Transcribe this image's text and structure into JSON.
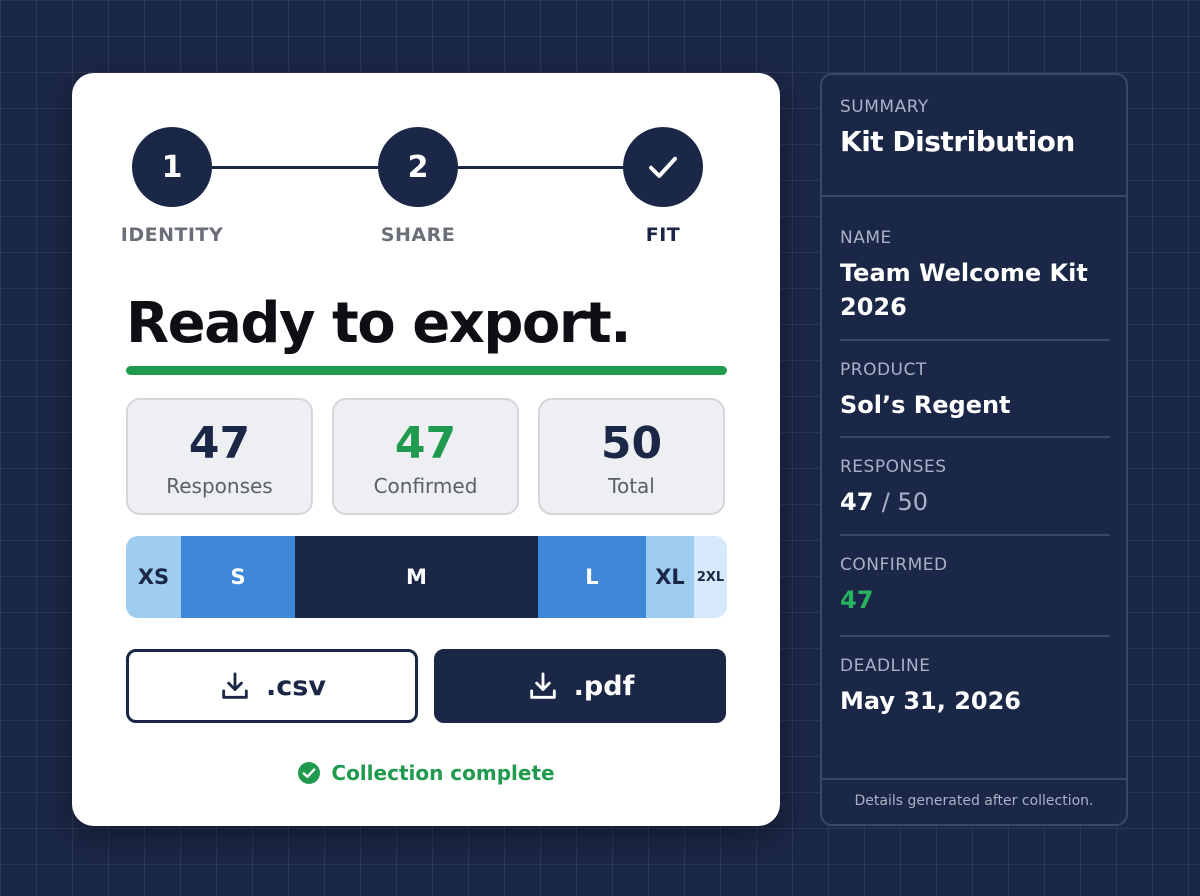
{
  "stepper": {
    "steps": [
      {
        "marker": "1",
        "label": "IDENTITY"
      },
      {
        "marker": "2",
        "label": "SHARE"
      },
      {
        "marker": "check-icon",
        "label": "FIT"
      }
    ]
  },
  "headline": "Ready to export.",
  "stats": [
    {
      "value": "47",
      "label": "Responses"
    },
    {
      "value": "47",
      "label": "Confirmed"
    },
    {
      "value": "50",
      "label": "Total"
    }
  ],
  "size_distribution": {
    "segments": [
      {
        "label": "XS"
      },
      {
        "label": "S"
      },
      {
        "label": "M"
      },
      {
        "label": "L"
      },
      {
        "label": "XL"
      },
      {
        "label": "2XL"
      }
    ]
  },
  "buttons": {
    "csv_label": ".csv",
    "pdf_label": ".pdf",
    "icon": "download-icon"
  },
  "status": {
    "icon": "check-circle-icon",
    "text": "Collection complete"
  },
  "summary": {
    "eyebrow": "SUMMARY",
    "title": "Kit Distribution",
    "name_label": "NAME",
    "name_value": "Team Welcome Kit 2026",
    "product_label": "PRODUCT",
    "product_value": "Sol’s Regent",
    "responses_label": "RESPONSES",
    "responses_value": "47",
    "responses_total": "/ 50",
    "confirmed_label": "CONFIRMED",
    "confirmed_value": "47",
    "deadline_label": "DEADLINE",
    "deadline_value": "May 31, 2026",
    "footer": "Details generated after collection."
  },
  "colors": {
    "navy": "#1b2746",
    "accent_green": "#1f9a4f",
    "size_blue": "#3f87d9",
    "size_light_blue": "#9fcdef"
  }
}
